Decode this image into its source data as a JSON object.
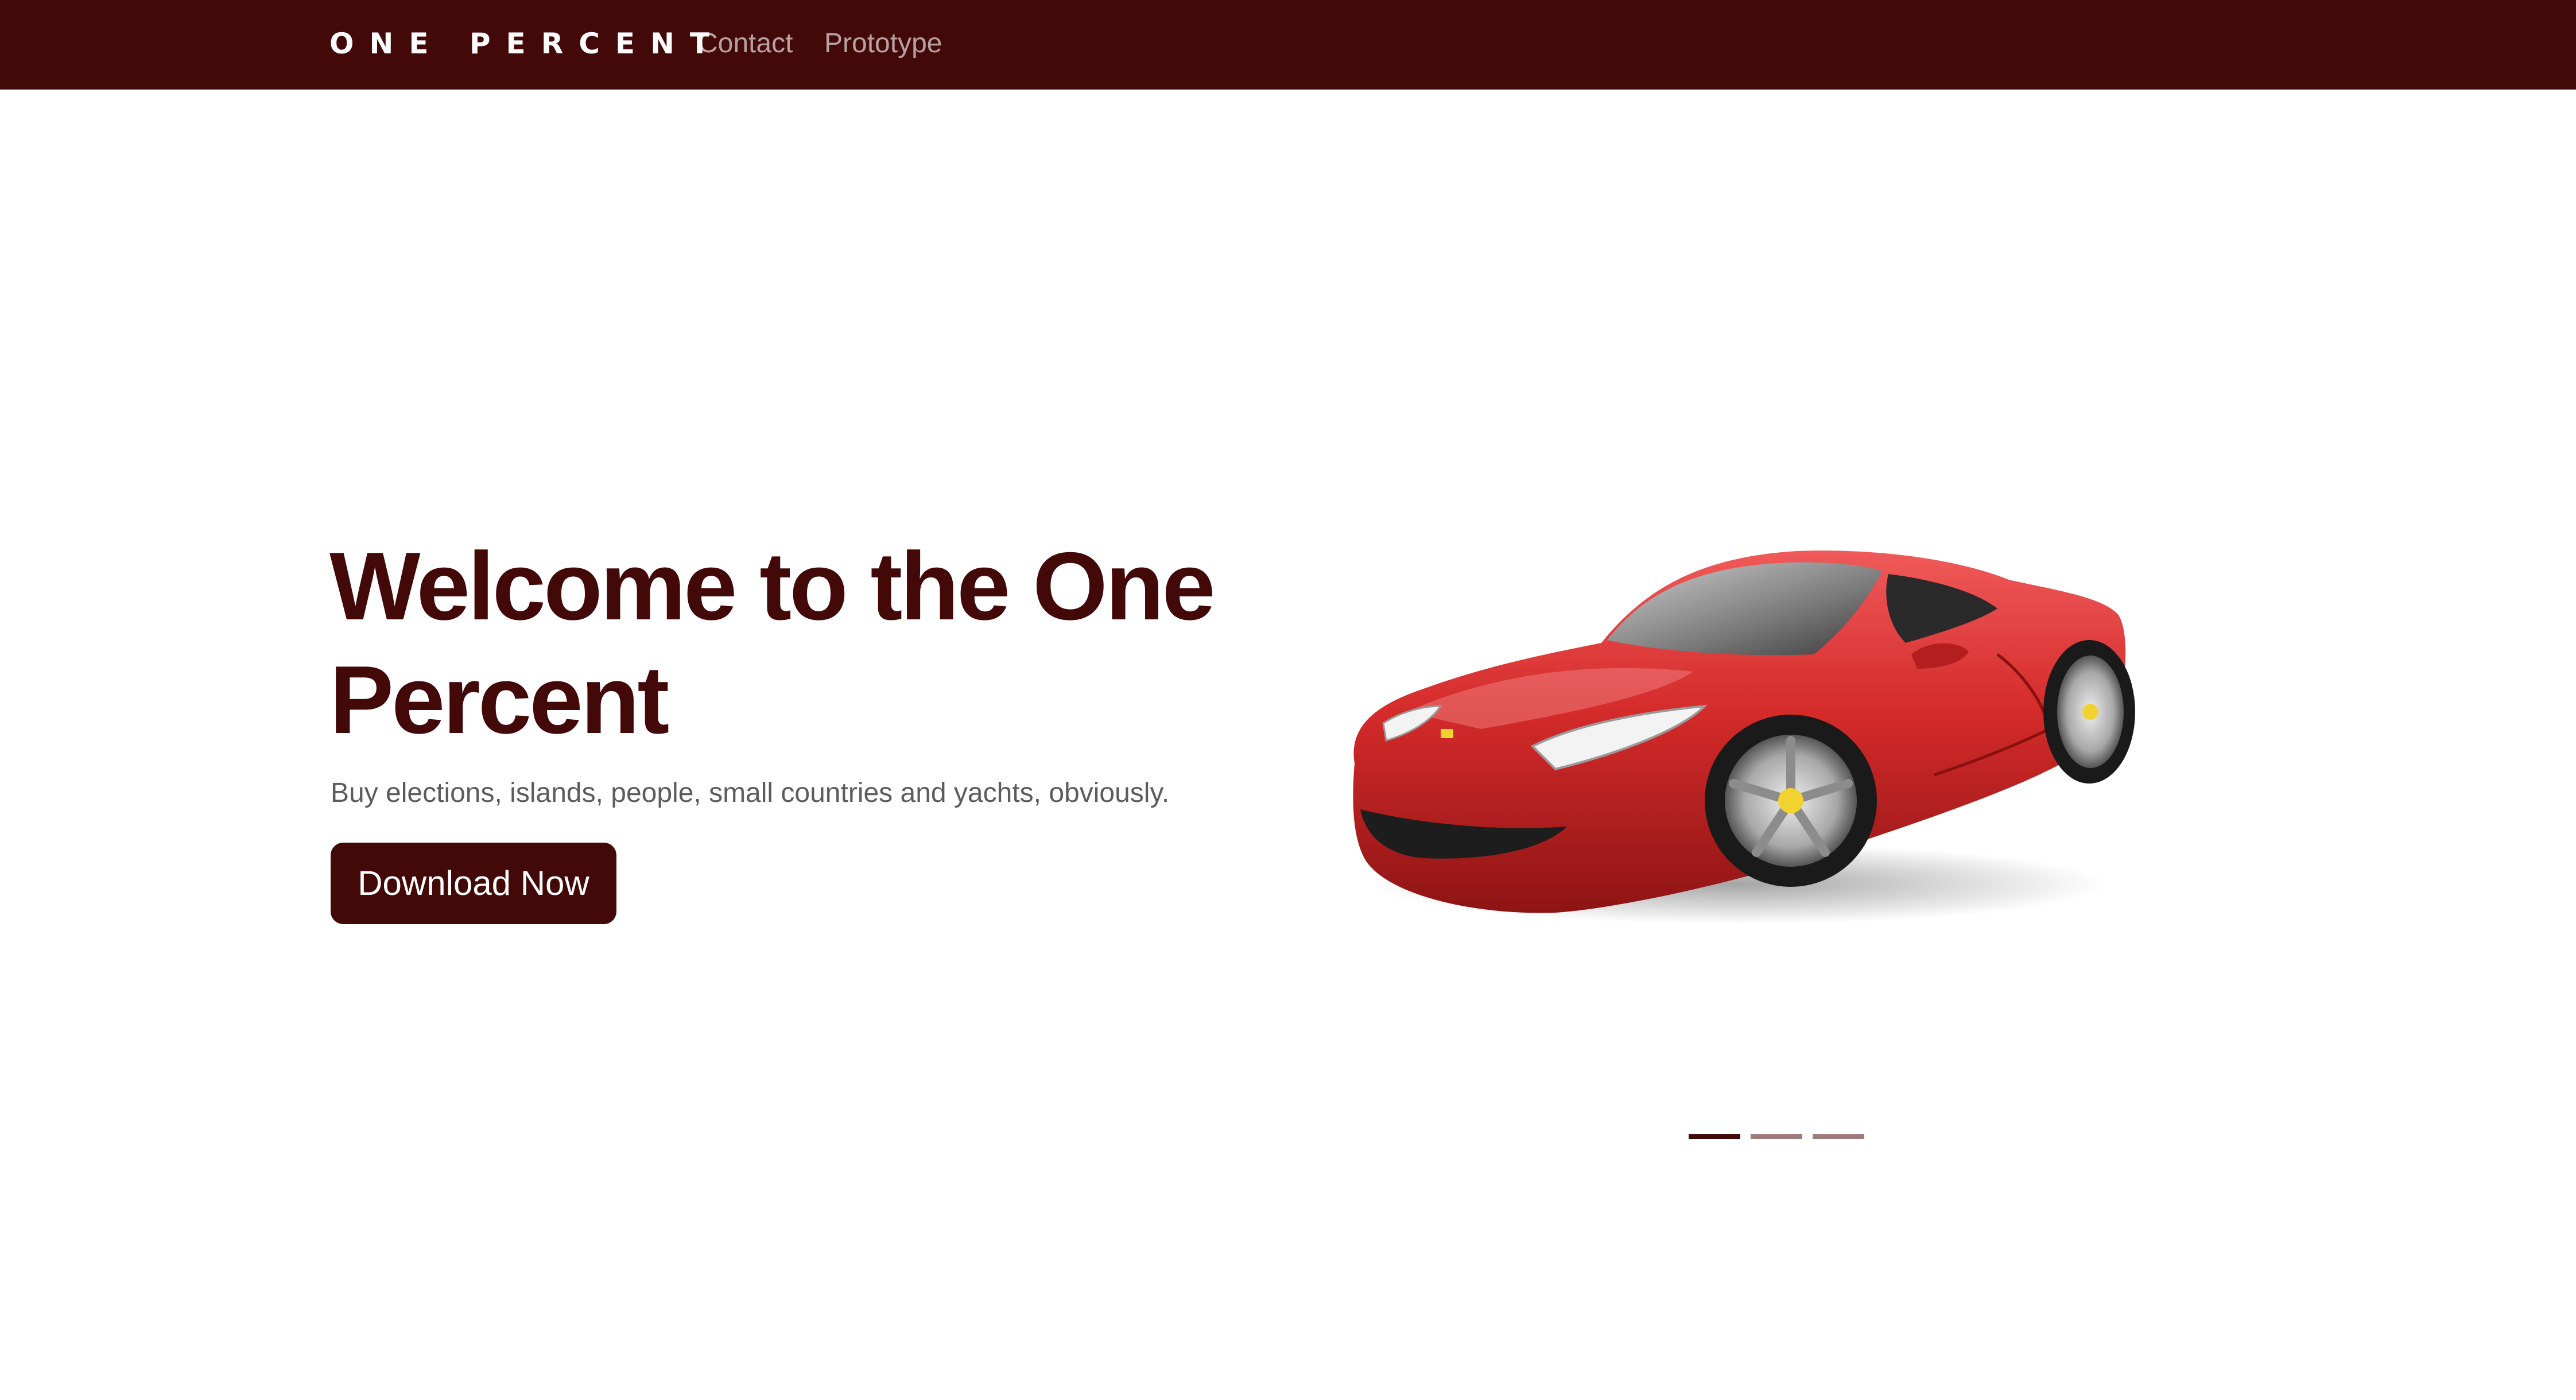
{
  "navbar": {
    "brand": "ONE PERCENT",
    "links": [
      {
        "label": "Contact"
      },
      {
        "label": "Prototype"
      }
    ]
  },
  "hero": {
    "title": "Welcome to the One Percent",
    "subtitle": "Buy elections, islands, people, small countries and yachts, obviously.",
    "cta_label": "Download Now",
    "image_icon": "red-sports-car-image"
  },
  "carousel": {
    "slide_count": 3,
    "active_index": 0
  },
  "colors": {
    "brand": "#430808",
    "indicator_inactive": "#a07b7b",
    "car_red": "#d42a2a",
    "subtitle_text": "#5c5c5c"
  }
}
